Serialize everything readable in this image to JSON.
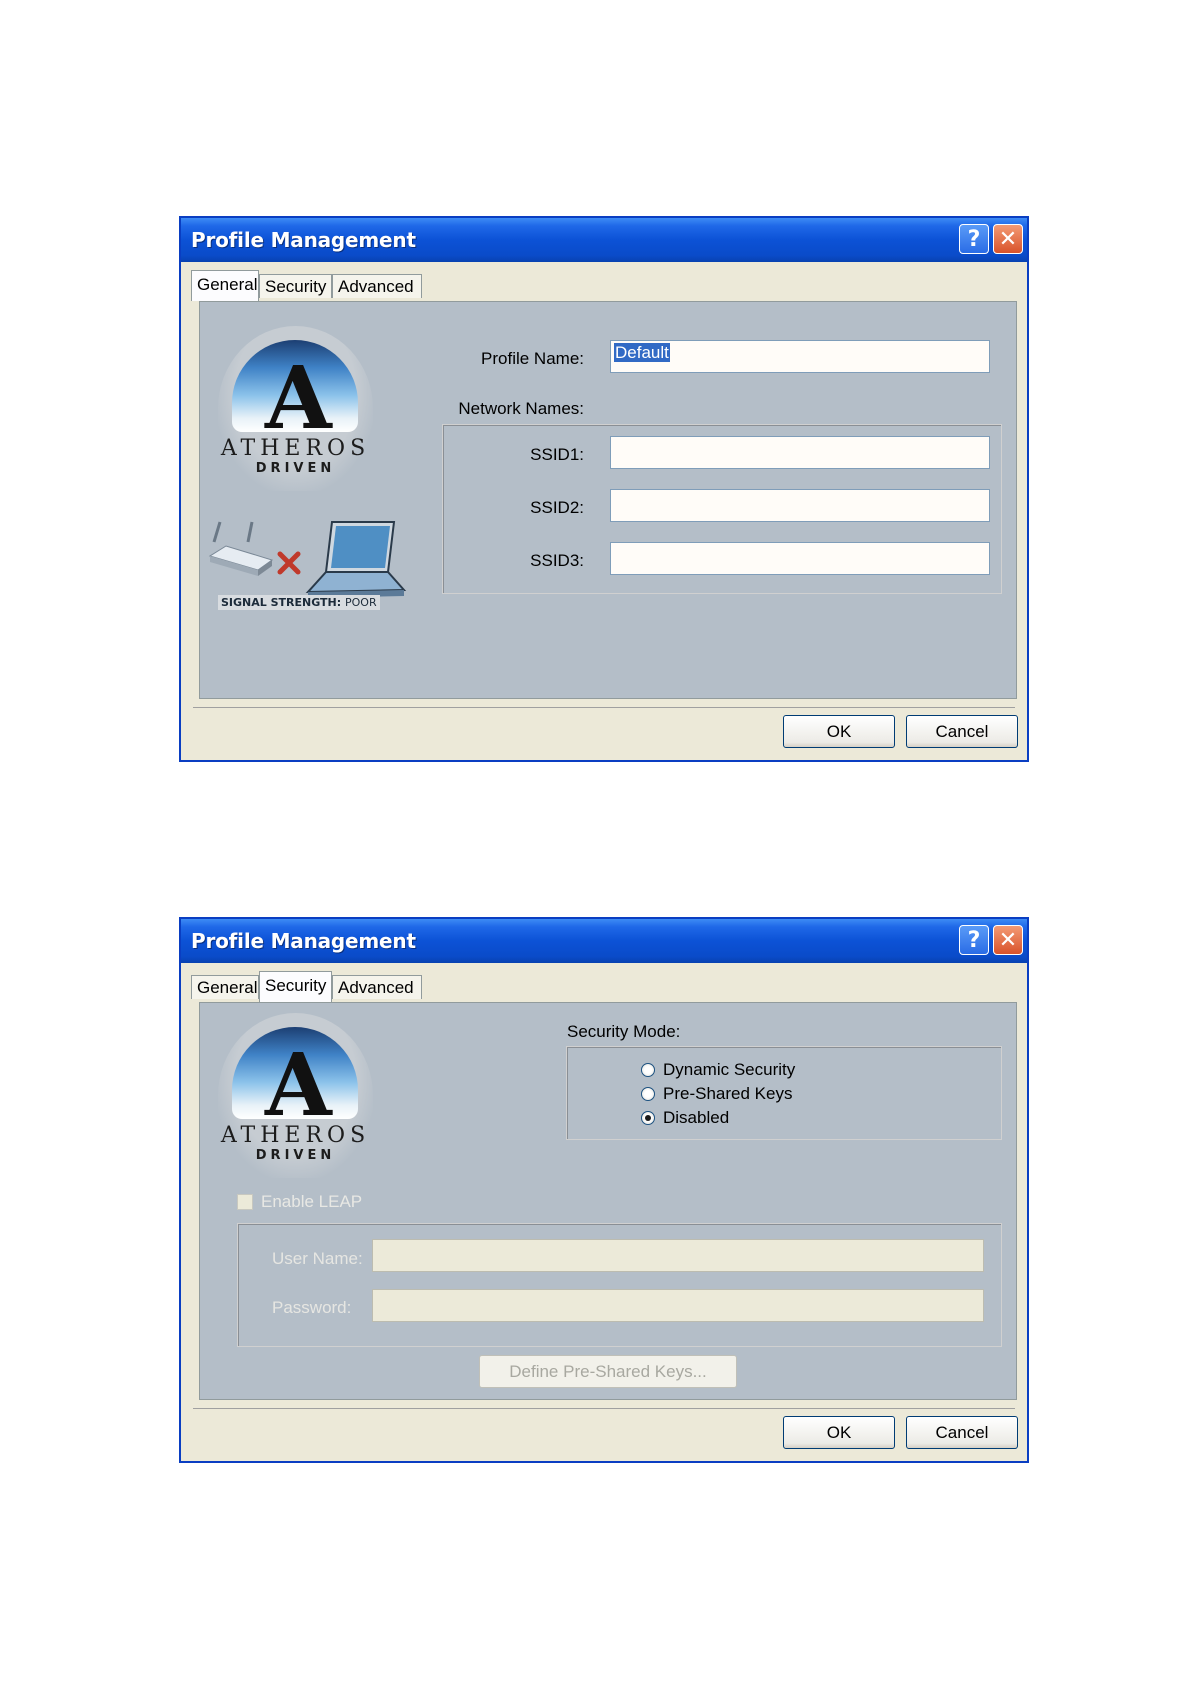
{
  "dialog1": {
    "title": "Profile Management",
    "tabs": [
      "General",
      "Security",
      "Advanced"
    ],
    "active_tab": "General",
    "logo_word1": "ATHEROS",
    "logo_word2": "DRIVEN",
    "signal_label": "SIGNAL STRENGTH:",
    "signal_value": "POOR",
    "profile_name_label": "Profile Name:",
    "profile_name_value": "Default",
    "network_names_label": "Network Names:",
    "ssid1_label": "SSID1:",
    "ssid2_label": "SSID2:",
    "ssid3_label": "SSID3:",
    "ssid1_value": "",
    "ssid2_value": "",
    "ssid3_value": "",
    "ok_label": "OK",
    "cancel_label": "Cancel"
  },
  "dialog2": {
    "title": "Profile Management",
    "tabs": [
      "General",
      "Security",
      "Advanced"
    ],
    "active_tab": "Security",
    "logo_word1": "ATHEROS",
    "logo_word2": "DRIVEN",
    "security_mode_label": "Security Mode:",
    "options": [
      "Dynamic Security",
      "Pre-Shared Keys",
      "Disabled"
    ],
    "selected_option": "Disabled",
    "enable_leap_label": "Enable LEAP",
    "enable_leap_checked": false,
    "user_name_label": "User Name:",
    "password_label": "Password:",
    "user_name_value": "",
    "password_value": "",
    "define_keys_label": "Define Pre-Shared Keys...",
    "ok_label": "OK",
    "cancel_label": "Cancel"
  },
  "colors": {
    "titlebar": "#0c52d6",
    "panel_bg": "#b4bec8",
    "dialog_bg": "#ece9d8",
    "selection": "#316ac5",
    "error_x": "#c0392b"
  }
}
